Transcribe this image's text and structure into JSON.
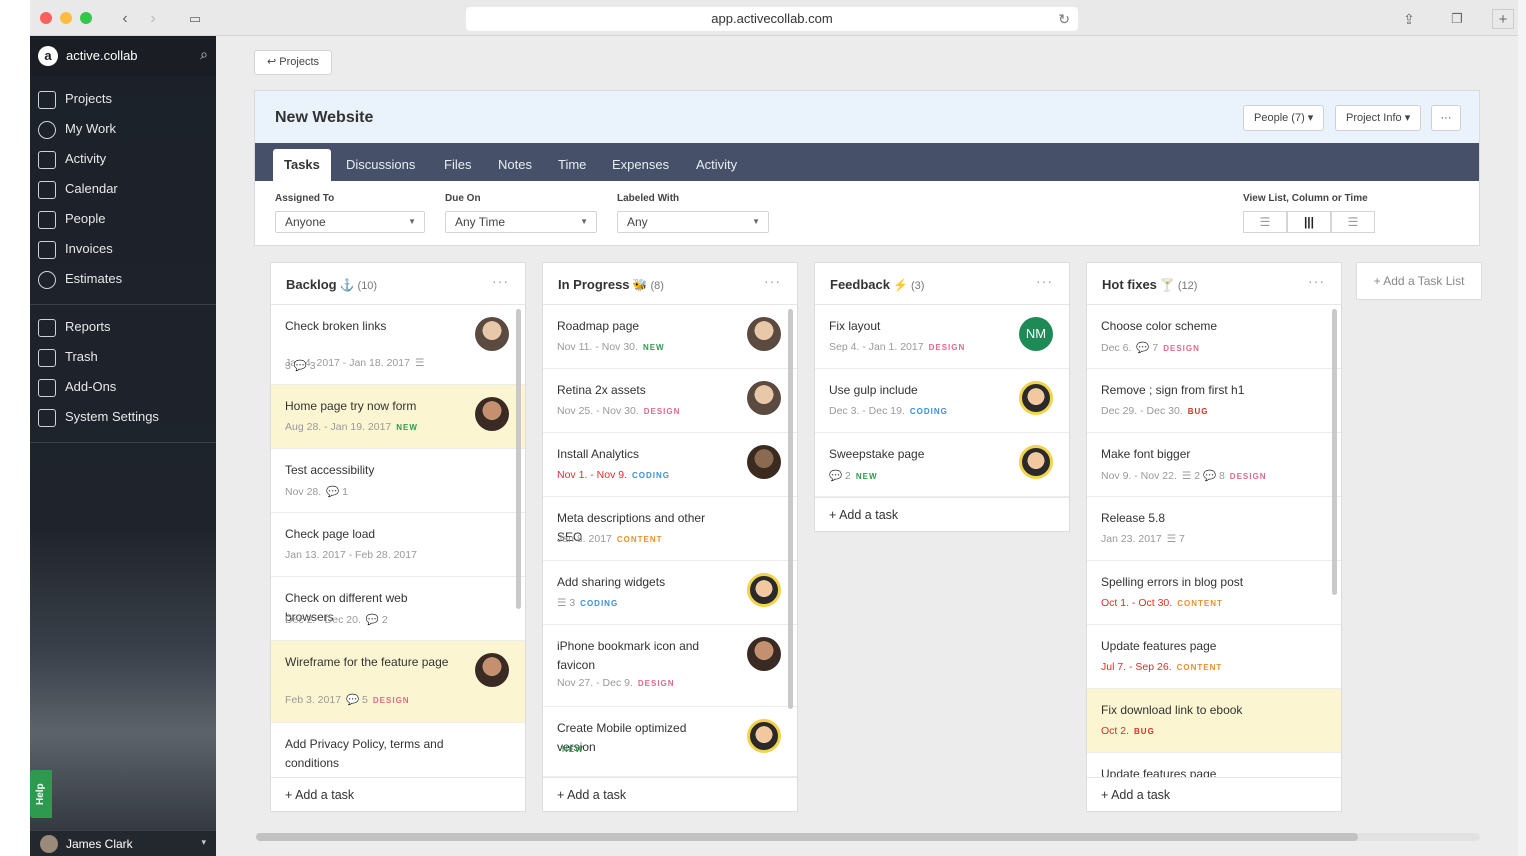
{
  "browser": {
    "url": "app.activecollab.com"
  },
  "sidebar": {
    "brand": "active.collab",
    "items_top": [
      {
        "label": "Projects",
        "icon": "projects-icon"
      },
      {
        "label": "My Work",
        "icon": "my-work-icon"
      },
      {
        "label": "Activity",
        "icon": "activity-icon"
      },
      {
        "label": "Calendar",
        "icon": "calendar-icon"
      },
      {
        "label": "People",
        "icon": "people-icon"
      },
      {
        "label": "Invoices",
        "icon": "invoices-icon"
      },
      {
        "label": "Estimates",
        "icon": "estimates-icon"
      }
    ],
    "items_bottom": [
      {
        "label": "Reports",
        "icon": "reports-icon"
      },
      {
        "label": "Trash",
        "icon": "trash-icon"
      },
      {
        "label": "Add-Ons",
        "icon": "add-ons-icon"
      },
      {
        "label": "System Settings",
        "icon": "system-settings-icon"
      }
    ],
    "help": "Help",
    "user": "James Clark"
  },
  "crumb": "↩ Projects",
  "project": {
    "title": "New Website",
    "people_btn": "People (7) ▾",
    "info_btn": "Project Info ▾",
    "more_btn": "···",
    "tabs": [
      "Tasks",
      "Discussions",
      "Files",
      "Notes",
      "Time",
      "Expenses",
      "Activity"
    ],
    "filters": {
      "assigned_label": "Assigned To",
      "assigned_value": "Anyone",
      "due_label": "Due On",
      "due_value": "Any Time",
      "labeled_label": "Labeled With",
      "labeled_value": "Any",
      "view_label": "View List, Column or Time"
    }
  },
  "colors": {
    "new": "#2e9a4f",
    "design": "#e06a8a",
    "coding": "#3c8fd6",
    "content": "#e8912d",
    "bug": "#d9302c"
  },
  "columns": [
    {
      "title": "Backlog",
      "emoji": "⚓",
      "count": "(10)",
      "cards": [
        {
          "title": "Check broken links",
          "due": "Jan 4. 2017 - Jan 18. 2017",
          "due_red": false,
          "extra": "☰",
          "line2": "3 💬 3",
          "label": "",
          "avatar": "av-a",
          "hl": false,
          "h": 80
        },
        {
          "title": "Home page try now form",
          "due": "Aug 28. - Jan 19. 2017",
          "due_red": false,
          "extra": "",
          "label": "NEW",
          "avatar": "av-b",
          "hl": true,
          "h": 64
        },
        {
          "title": "Test accessibility",
          "due": "Nov 28.",
          "due_red": false,
          "extra": "💬 1",
          "label": "",
          "avatar": "",
          "hl": false,
          "h": 64
        },
        {
          "title": "Check page load",
          "due": "Jan 13. 2017 - Feb 28. 2017",
          "due_red": false,
          "extra": "",
          "label": "",
          "avatar": "",
          "hl": false,
          "h": 64
        },
        {
          "title": "Check on different web browsers",
          "due": "Dec 2. - Dec 20.",
          "due_red": false,
          "extra": "💬 2",
          "label": "",
          "avatar": "",
          "hl": false,
          "h": 64
        },
        {
          "title": "Wireframe for the feature page",
          "due": "Feb 3. 2017",
          "due_red": false,
          "extra": "💬 5",
          "label": "DESIGN",
          "avatar": "av-b",
          "hl": true,
          "h": 82
        },
        {
          "title": "Add Privacy Policy, terms and conditions",
          "due": "",
          "due_red": false,
          "extra": "",
          "label": "",
          "avatar": "",
          "hl": false,
          "h": 56
        }
      ],
      "add": "+ Add a task"
    },
    {
      "title": "In Progress",
      "emoji": "🐝",
      "count": "(8)",
      "cards": [
        {
          "title": "Roadmap page",
          "due": "Nov 11. - Nov 30.",
          "due_red": false,
          "extra": "",
          "label": "NEW",
          "avatar": "av-a",
          "hl": false,
          "h": 64
        },
        {
          "title": "Retina 2x assets",
          "due": "Nov 25. - Nov 30.",
          "due_red": false,
          "extra": "",
          "label": "DESIGN",
          "avatar": "av-a",
          "hl": false,
          "h": 64
        },
        {
          "title": "Install Analytics",
          "due": "Nov 1. - Nov 9.",
          "due_red": true,
          "extra": "",
          "label": "CODING",
          "avatar": "av-d",
          "hl": false,
          "h": 64
        },
        {
          "title": "Meta descriptions and other SEO",
          "due": "Jan 8. 2017",
          "due_red": false,
          "extra": "",
          "label": "CONTENT",
          "avatar": "",
          "hl": false,
          "h": 64
        },
        {
          "title": "Add sharing widgets",
          "due": "",
          "due_red": false,
          "extra": "☰ 3",
          "label": "CODING",
          "avatar": "av-c",
          "hl": false,
          "h": 64
        },
        {
          "title": "iPhone bookmark icon and favicon",
          "due": "Nov 27. - Dec 9.",
          "due_red": false,
          "extra": "",
          "label": "DESIGN",
          "avatar": "av-b",
          "hl": false,
          "h": 82
        },
        {
          "title": "Create Mobile optimized version",
          "due": "",
          "due_red": false,
          "extra": "",
          "label": "NEW",
          "avatar": "av-c",
          "hl": false,
          "h": 70
        }
      ],
      "add": "+ Add a task"
    },
    {
      "title": "Feedback",
      "emoji": "⚡",
      "count": "(3)",
      "cards": [
        {
          "title": "Fix layout",
          "due": "Sep 4. - Jan 1. 2017",
          "due_red": false,
          "extra": "",
          "label": "DESIGN",
          "avatar": "av-nm",
          "avatar_text": "NM",
          "hl": false,
          "h": 64
        },
        {
          "title": "Use gulp include",
          "due": "Dec 3. - Dec 19.",
          "due_red": false,
          "extra": "",
          "label": "CODING",
          "avatar": "av-c",
          "hl": false,
          "h": 64
        },
        {
          "title": "Sweepstake page",
          "due": "",
          "due_red": false,
          "extra": "💬 2",
          "label": "NEW",
          "avatar": "av-c",
          "hl": false,
          "h": 64
        }
      ],
      "add": "+ Add a task"
    },
    {
      "title": "Hot fixes",
      "emoji": "🍸",
      "count": "(12)",
      "cards": [
        {
          "title": "Choose color scheme",
          "due": "Dec 6.",
          "due_red": false,
          "extra": "💬 7",
          "label": "DESIGN",
          "avatar": "",
          "hl": false,
          "h": 64
        },
        {
          "title": "Remove ; sign from first h1",
          "due": "Dec 29. - Dec 30.",
          "due_red": false,
          "extra": "",
          "label": "BUG",
          "avatar": "",
          "hl": false,
          "h": 64
        },
        {
          "title": "Make font bigger",
          "due": "Nov 9. - Nov 22.",
          "due_red": false,
          "extra": "☰ 2 💬 8",
          "label": "DESIGN",
          "avatar": "",
          "hl": false,
          "h": 64
        },
        {
          "title": "Release 5.8",
          "due": "Jan 23. 2017",
          "due_red": false,
          "extra": "☰ 7",
          "label": "",
          "avatar": "",
          "hl": false,
          "h": 64
        },
        {
          "title": "Spelling errors in blog post",
          "due": "Oct 1. - Oct 30.",
          "due_red": true,
          "extra": "",
          "label": "CONTENT",
          "avatar": "",
          "hl": false,
          "h": 64
        },
        {
          "title": "Update features page",
          "due": "Jul 7. - Sep 26.",
          "due_red": true,
          "extra": "",
          "label": "CONTENT",
          "avatar": "",
          "hl": false,
          "h": 64
        },
        {
          "title": "Fix download link to ebook",
          "due": "Oct 2.",
          "due_red": true,
          "extra": "",
          "label": "BUG",
          "avatar": "",
          "hl": true,
          "h": 64
        },
        {
          "title": "Update features page",
          "due": "",
          "due_red": false,
          "extra": "",
          "label": "",
          "avatar": "",
          "hl": false,
          "h": 26
        }
      ],
      "add": "+ Add a task"
    }
  ],
  "add_list": "+ Add a Task List"
}
